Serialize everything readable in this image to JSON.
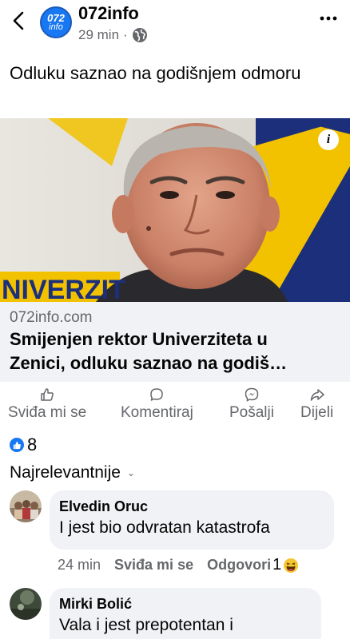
{
  "header": {
    "page_name": "072info",
    "avatar_line1": "072",
    "avatar_line2": "info",
    "time": "29 min",
    "dot": "·",
    "back_icon": "chevron-left-icon",
    "privacy_icon": "globe-icon",
    "more_icon": "more-dots-icon"
  },
  "post": {
    "text": "Odluku saznao na godišnjem odmoru",
    "image_info_label": "i",
    "image_banner_text": "NIVERZIT"
  },
  "link_preview": {
    "domain": "072info.com",
    "title_line1": "Smijenjen rektor Univerziteta u",
    "title_line2": "Zenici, odluku saznao na godiš…"
  },
  "actions": {
    "like": "Sviđa mi se",
    "comment": "Komentiraj",
    "send": "Pošalji",
    "share": "Dijeli"
  },
  "reactions": {
    "count": "8",
    "icon": "like-reaction-icon"
  },
  "sort": {
    "label": "Najrelevantnije",
    "chevron": "⌄"
  },
  "comments": [
    {
      "author": "Elvedin Oruc",
      "text": "I jest bio odvratan katastrofa",
      "time": "24 min",
      "like_label": "Sviđa mi se",
      "reply_label": "Odgovori",
      "reaction_count": "1"
    },
    {
      "author": "Mirki Bolić",
      "text": "Vala i jest prepotentan i"
    }
  ],
  "colors": {
    "accent": "#1877f2",
    "secondary_text": "#65676b",
    "bubble_bg": "#f0f2f5"
  }
}
